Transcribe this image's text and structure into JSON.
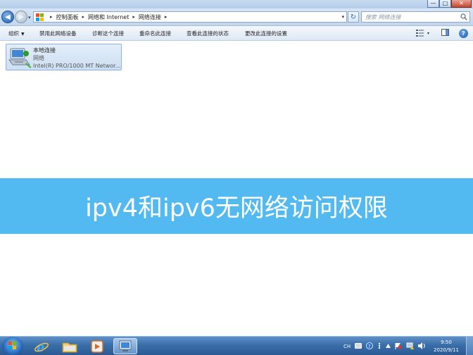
{
  "window": {
    "minimize_glyph": "—",
    "maximize_glyph": "□",
    "close_glyph": "✕"
  },
  "navigation": {
    "back_glyph": "◀",
    "forward_glyph": "▶",
    "dropdown_glyph": "▾",
    "breadcrumbs": [
      "控制面板",
      "网络和 Internet",
      "网络连接"
    ],
    "separator_glyph": "▸",
    "address_dropdown_glyph": "▾",
    "refresh_glyph": "↻"
  },
  "search": {
    "placeholder": "搜索 网络连接"
  },
  "commands": [
    {
      "label": "组织",
      "has_dropdown": true
    },
    {
      "label": "禁用此网络设备"
    },
    {
      "label": "诊断这个连接"
    },
    {
      "label": "重命名此连接"
    },
    {
      "label": "查看此连接的状态"
    },
    {
      "label": "更改此连接的设置"
    }
  ],
  "view_dropdown_glyph": "▾",
  "help_glyph": "?",
  "connection": {
    "name": "本地连接",
    "status": "网络",
    "adapter": "Intel(R) PRO/1000 MT Networ..."
  },
  "banner": {
    "text": "ipv4和ipv6无网络访问权限",
    "background": "#53b9f1"
  },
  "taskbar": {
    "apps": [
      "start-orb",
      "internet-explorer",
      "file-explorer",
      "media-player",
      "network-connections"
    ],
    "tray": {
      "language": "CH",
      "time": "9:50",
      "date": "2020/9/11"
    }
  }
}
